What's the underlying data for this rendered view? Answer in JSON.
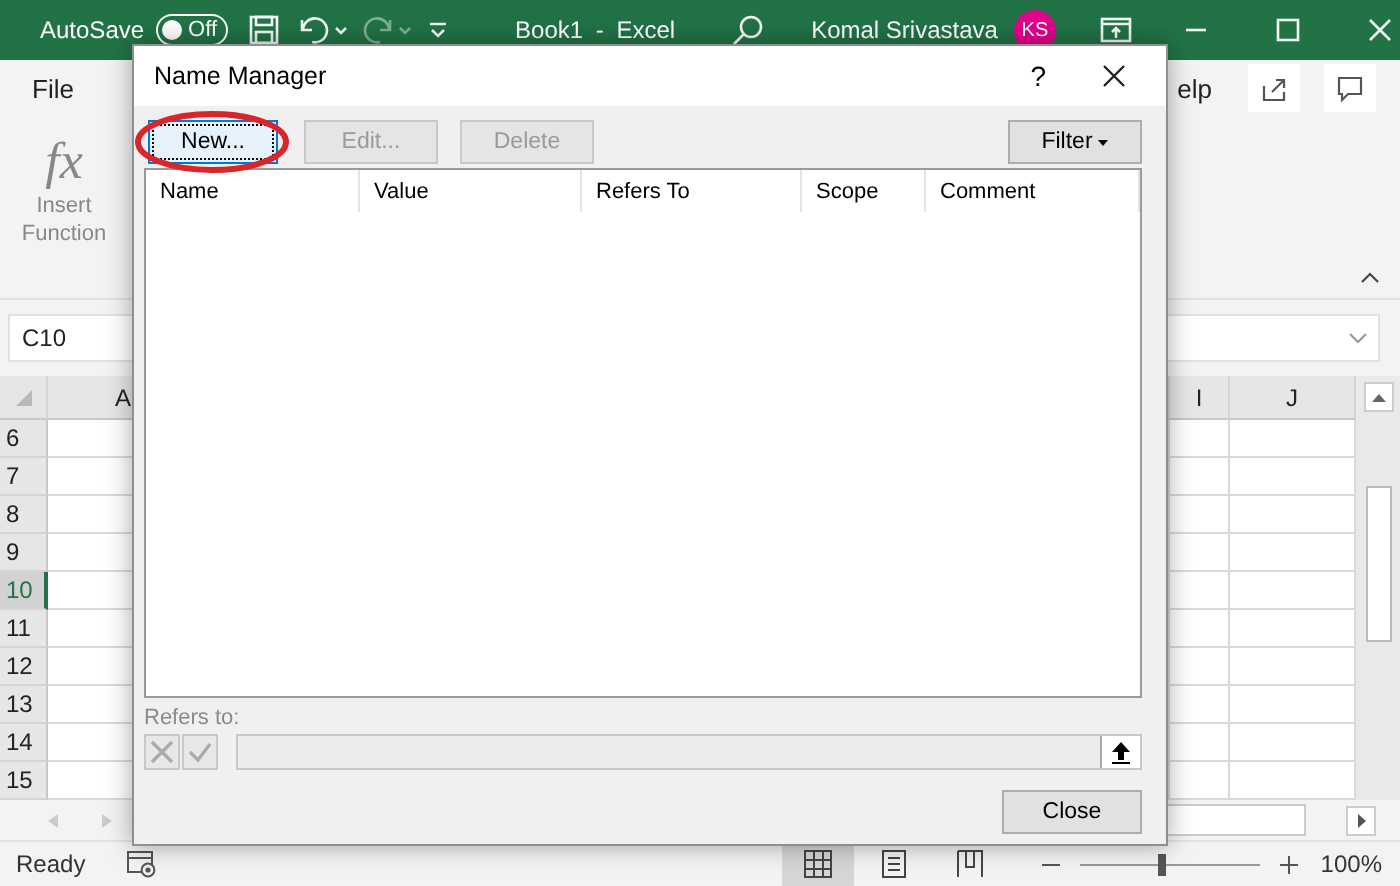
{
  "excel": {
    "autosave": {
      "label": "AutoSave",
      "toggle_text": "Off",
      "on": false
    },
    "title": "Book1 - Excel",
    "user": "Komal Srivastava",
    "avatar": "KS",
    "ribbon_tabs": [
      {
        "label": "File"
      },
      {
        "label": "elp"
      }
    ],
    "ribbon_command": {
      "icon_text": "fx",
      "label": "Insert Function"
    },
    "name_box": "C10",
    "columns": [
      "A",
      "I",
      "J"
    ],
    "rows": [
      {
        "label": "6",
        "selected": false
      },
      {
        "label": "7",
        "selected": false
      },
      {
        "label": "8",
        "selected": false
      },
      {
        "label": "9",
        "selected": false
      },
      {
        "label": "10",
        "selected": true
      },
      {
        "label": "11",
        "selected": false
      },
      {
        "label": "12",
        "selected": false
      },
      {
        "label": "13",
        "selected": false
      },
      {
        "label": "14",
        "selected": false
      },
      {
        "label": "15",
        "selected": false
      }
    ],
    "status_bar": {
      "status": "Ready",
      "views": [
        {
          "kind": "normal",
          "selected": true
        },
        {
          "kind": "page_layout",
          "selected": false
        },
        {
          "kind": "page_break",
          "selected": false
        }
      ],
      "zoom": {
        "level": 0.45,
        "reading": "100%"
      }
    }
  },
  "dialog": {
    "title": "Name Manager",
    "help": "?",
    "buttons": [
      {
        "label": "New...",
        "disabled": false,
        "focused": true
      },
      {
        "label": "Edit...",
        "disabled": true,
        "focused": false
      },
      {
        "label": "Delete",
        "disabled": true,
        "focused": false
      }
    ],
    "filter": "Filter",
    "columns": [
      "Name",
      "Value",
      "Refers To",
      "Scope",
      "Comment"
    ],
    "refers_to_label": "Refers to:",
    "close": "Close"
  }
}
